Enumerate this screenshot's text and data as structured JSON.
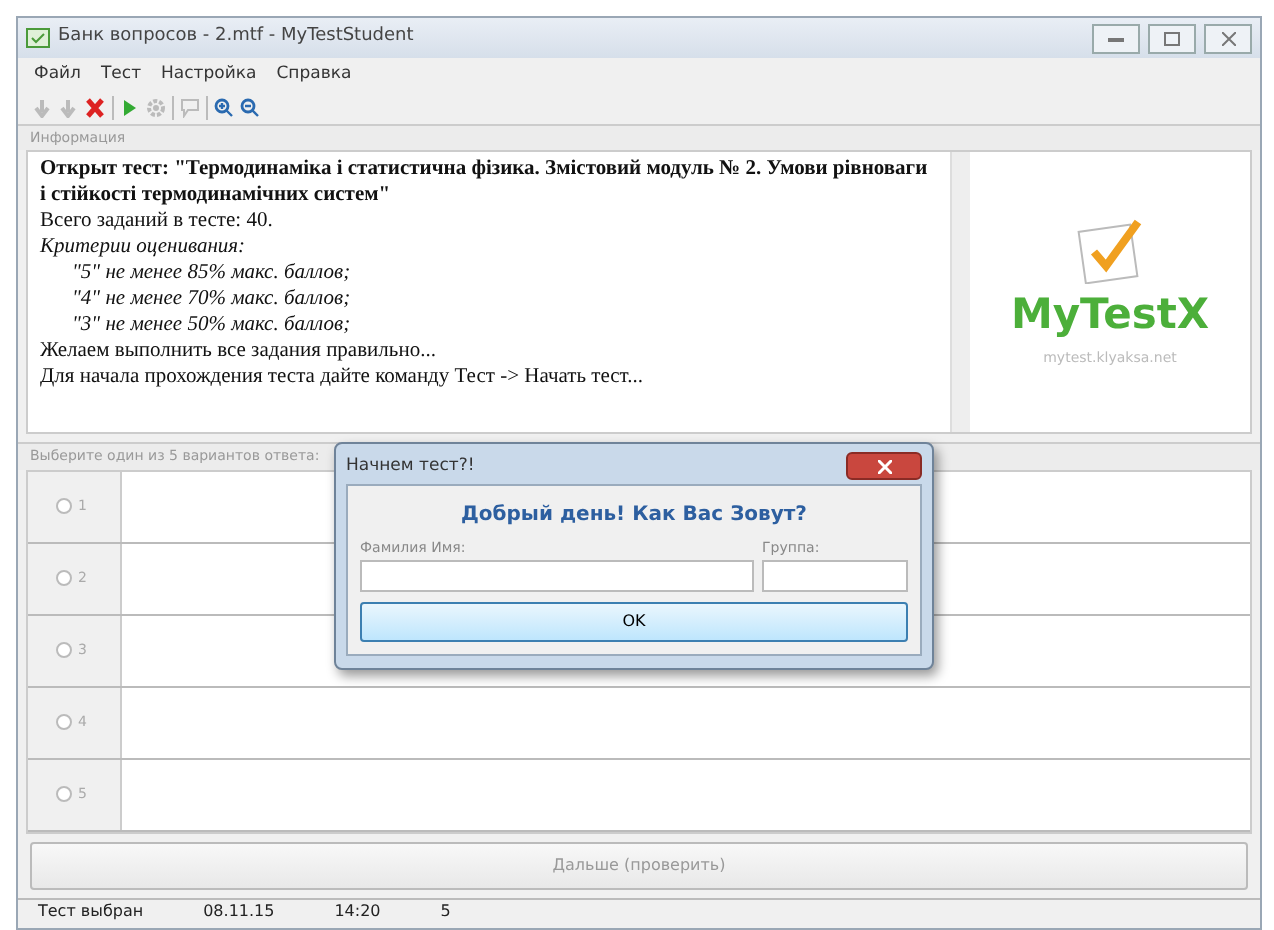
{
  "window": {
    "title": "Банк вопросов - 2.mtf - MyTestStudent"
  },
  "menu": [
    "Файл",
    "Тест",
    "Настройка",
    "Справка"
  ],
  "toolbar": [
    {
      "kind": "down",
      "disabled": true
    },
    {
      "kind": "down",
      "disabled": true
    },
    {
      "kind": "cross",
      "disabled": false
    },
    {
      "kind": "sep"
    },
    {
      "kind": "play",
      "disabled": false
    },
    {
      "kind": "gear",
      "disabled": true
    },
    {
      "kind": "sep"
    },
    {
      "kind": "chat",
      "disabled": true
    },
    {
      "kind": "sep"
    },
    {
      "kind": "zoom-in",
      "disabled": false
    },
    {
      "kind": "zoom-out",
      "disabled": false
    }
  ],
  "info": {
    "header": "Информация",
    "lines": [
      {
        "kind": "bold",
        "text": "Открыт тест: \"Термодинаміка і статистична фізика. Змістовий модуль № 2. Умови рівноваги і стійкості термодинамічних систем\""
      },
      {
        "kind": "plain",
        "text": "Всего заданий в тесте: 40."
      },
      {
        "kind": "italic",
        "text": "Критерии оценивания:"
      },
      {
        "kind": "italic-indent",
        "text": "\"5\" не менее 85% макс. баллов;"
      },
      {
        "kind": "italic-indent",
        "text": "\"4\" не менее 70% макс. баллов;"
      },
      {
        "kind": "italic-indent",
        "text": "\"3\" не менее 50% макс. баллов;"
      },
      {
        "kind": "plain",
        "text": "Желаем выполнить все задания правильно..."
      },
      {
        "kind": "plain",
        "text": "Для начала прохождения теста дайте команду Тест -> Начать тест..."
      }
    ],
    "logo": {
      "name": "MyTestX",
      "url": "mytest.klyaksa.net"
    }
  },
  "answers": {
    "header": "Выберите один из 5 вариантов ответа:",
    "options": [
      {
        "number": "1",
        "selected": false
      },
      {
        "number": "2",
        "selected": false
      },
      {
        "number": "3",
        "selected": false
      },
      {
        "number": "4",
        "selected": false
      },
      {
        "number": "5",
        "selected": false
      }
    ]
  },
  "next_button": {
    "label": "Дальше (проверить)",
    "disabled": true
  },
  "status_bar": [
    "Тест выбран",
    "08.11.15",
    "14:20",
    "5"
  ],
  "dialog": {
    "title": "Начнем тест?!",
    "heading": "Добрый день! Как Вас Зовут?",
    "name_label": "Фамилия Имя:",
    "group_label": "Группа:",
    "ok": "OK"
  }
}
